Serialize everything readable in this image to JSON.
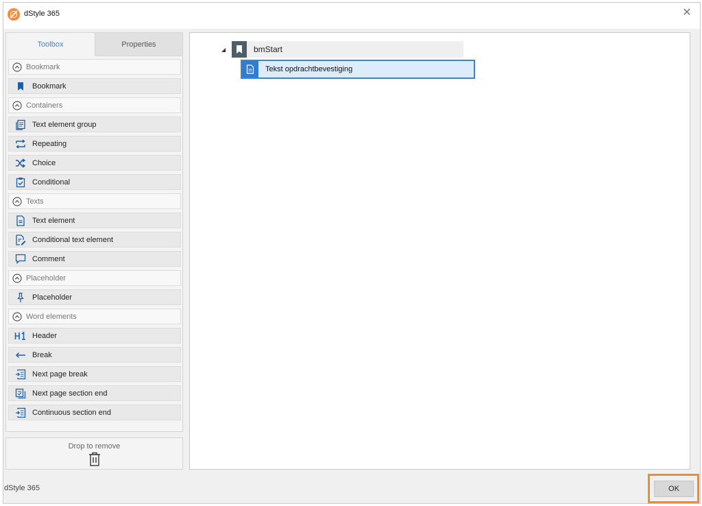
{
  "window": {
    "title": "dStyle 365",
    "close_glyph": "✕"
  },
  "tabs": [
    {
      "label": "Toolbox",
      "active": true
    },
    {
      "label": "Properties",
      "active": false
    }
  ],
  "toolbox": {
    "sections": [
      {
        "label": "Bookmark",
        "items": [
          {
            "label": "Bookmark",
            "icon": "bookmark-icon"
          }
        ]
      },
      {
        "label": "Containers",
        "items": [
          {
            "label": "Text element group",
            "icon": "text-element-group-icon"
          },
          {
            "label": "Repeating",
            "icon": "repeat-icon"
          },
          {
            "label": "Choice",
            "icon": "shuffle-icon"
          },
          {
            "label": "Conditional",
            "icon": "conditional-icon"
          }
        ]
      },
      {
        "label": "Texts",
        "items": [
          {
            "label": "Text element",
            "icon": "text-document-icon"
          },
          {
            "label": "Conditional text element",
            "icon": "conditional-text-icon"
          },
          {
            "label": "Comment",
            "icon": "comment-icon"
          }
        ]
      },
      {
        "label": "Placeholder",
        "items": [
          {
            "label": "Placeholder",
            "icon": "pin-icon"
          }
        ]
      },
      {
        "label": "Word elements",
        "items": [
          {
            "label": "Header",
            "icon": "h1-icon"
          },
          {
            "label": "Break",
            "icon": "break-arrow-icon"
          },
          {
            "label": "Next page break",
            "icon": "next-page-break-icon"
          },
          {
            "label": "Next page section end",
            "icon": "next-page-section-end-icon"
          },
          {
            "label": "Continuous section end",
            "icon": "continuous-section-end-icon"
          }
        ]
      }
    ]
  },
  "drop_zone": {
    "label": "Drop to remove",
    "icon": "trash-icon"
  },
  "tree": {
    "root": {
      "label": "bmStart",
      "icon": "bookmark-icon",
      "expanded": true
    },
    "children": [
      {
        "label": "Tekst opdrachtbevestiging",
        "icon": "text-document-icon",
        "selected": true
      }
    ]
  },
  "status_bar": {
    "text": "dStyle 365"
  },
  "buttons": {
    "ok_label": "OK"
  },
  "colors": {
    "accent": "#3a86c8",
    "highlight": "#f08c2a",
    "logo": "#f58a3a"
  }
}
